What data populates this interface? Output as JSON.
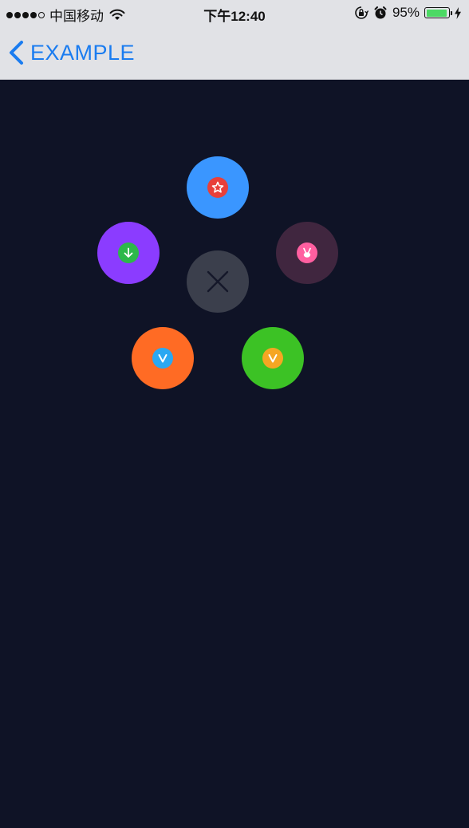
{
  "status_bar": {
    "carrier": "中国移动",
    "time": "下午12:40",
    "battery_percent": "95%",
    "battery_level": 0.95,
    "signal_bars_filled": 4,
    "signal_bars_total": 5,
    "battery_color": "#4cd964"
  },
  "nav": {
    "back_label": "EXAMPLE",
    "tint_color": "#1a7cf0"
  },
  "content": {
    "background": "#0f1326"
  },
  "menu": {
    "center": {
      "icon": "close-icon",
      "color": "#3b3f4c"
    },
    "items": [
      {
        "name": "star",
        "icon": "star-icon",
        "color": "#3a96ff",
        "badge_color": "#e8403a"
      },
      {
        "name": "download",
        "icon": "download-arrow-icon",
        "color": "#8b3cff",
        "badge_color": "#2db84a"
      },
      {
        "name": "rabbit",
        "icon": "rabbit-icon",
        "color": "#40263f",
        "badge_color": "#ff5fa0"
      },
      {
        "name": "v-blue",
        "icon": "v-icon",
        "color": "#ff6b24",
        "badge_color": "#2aa8f2"
      },
      {
        "name": "v-gold",
        "icon": "v-icon",
        "color": "#3cc225",
        "badge_color": "#f5a623"
      }
    ]
  }
}
